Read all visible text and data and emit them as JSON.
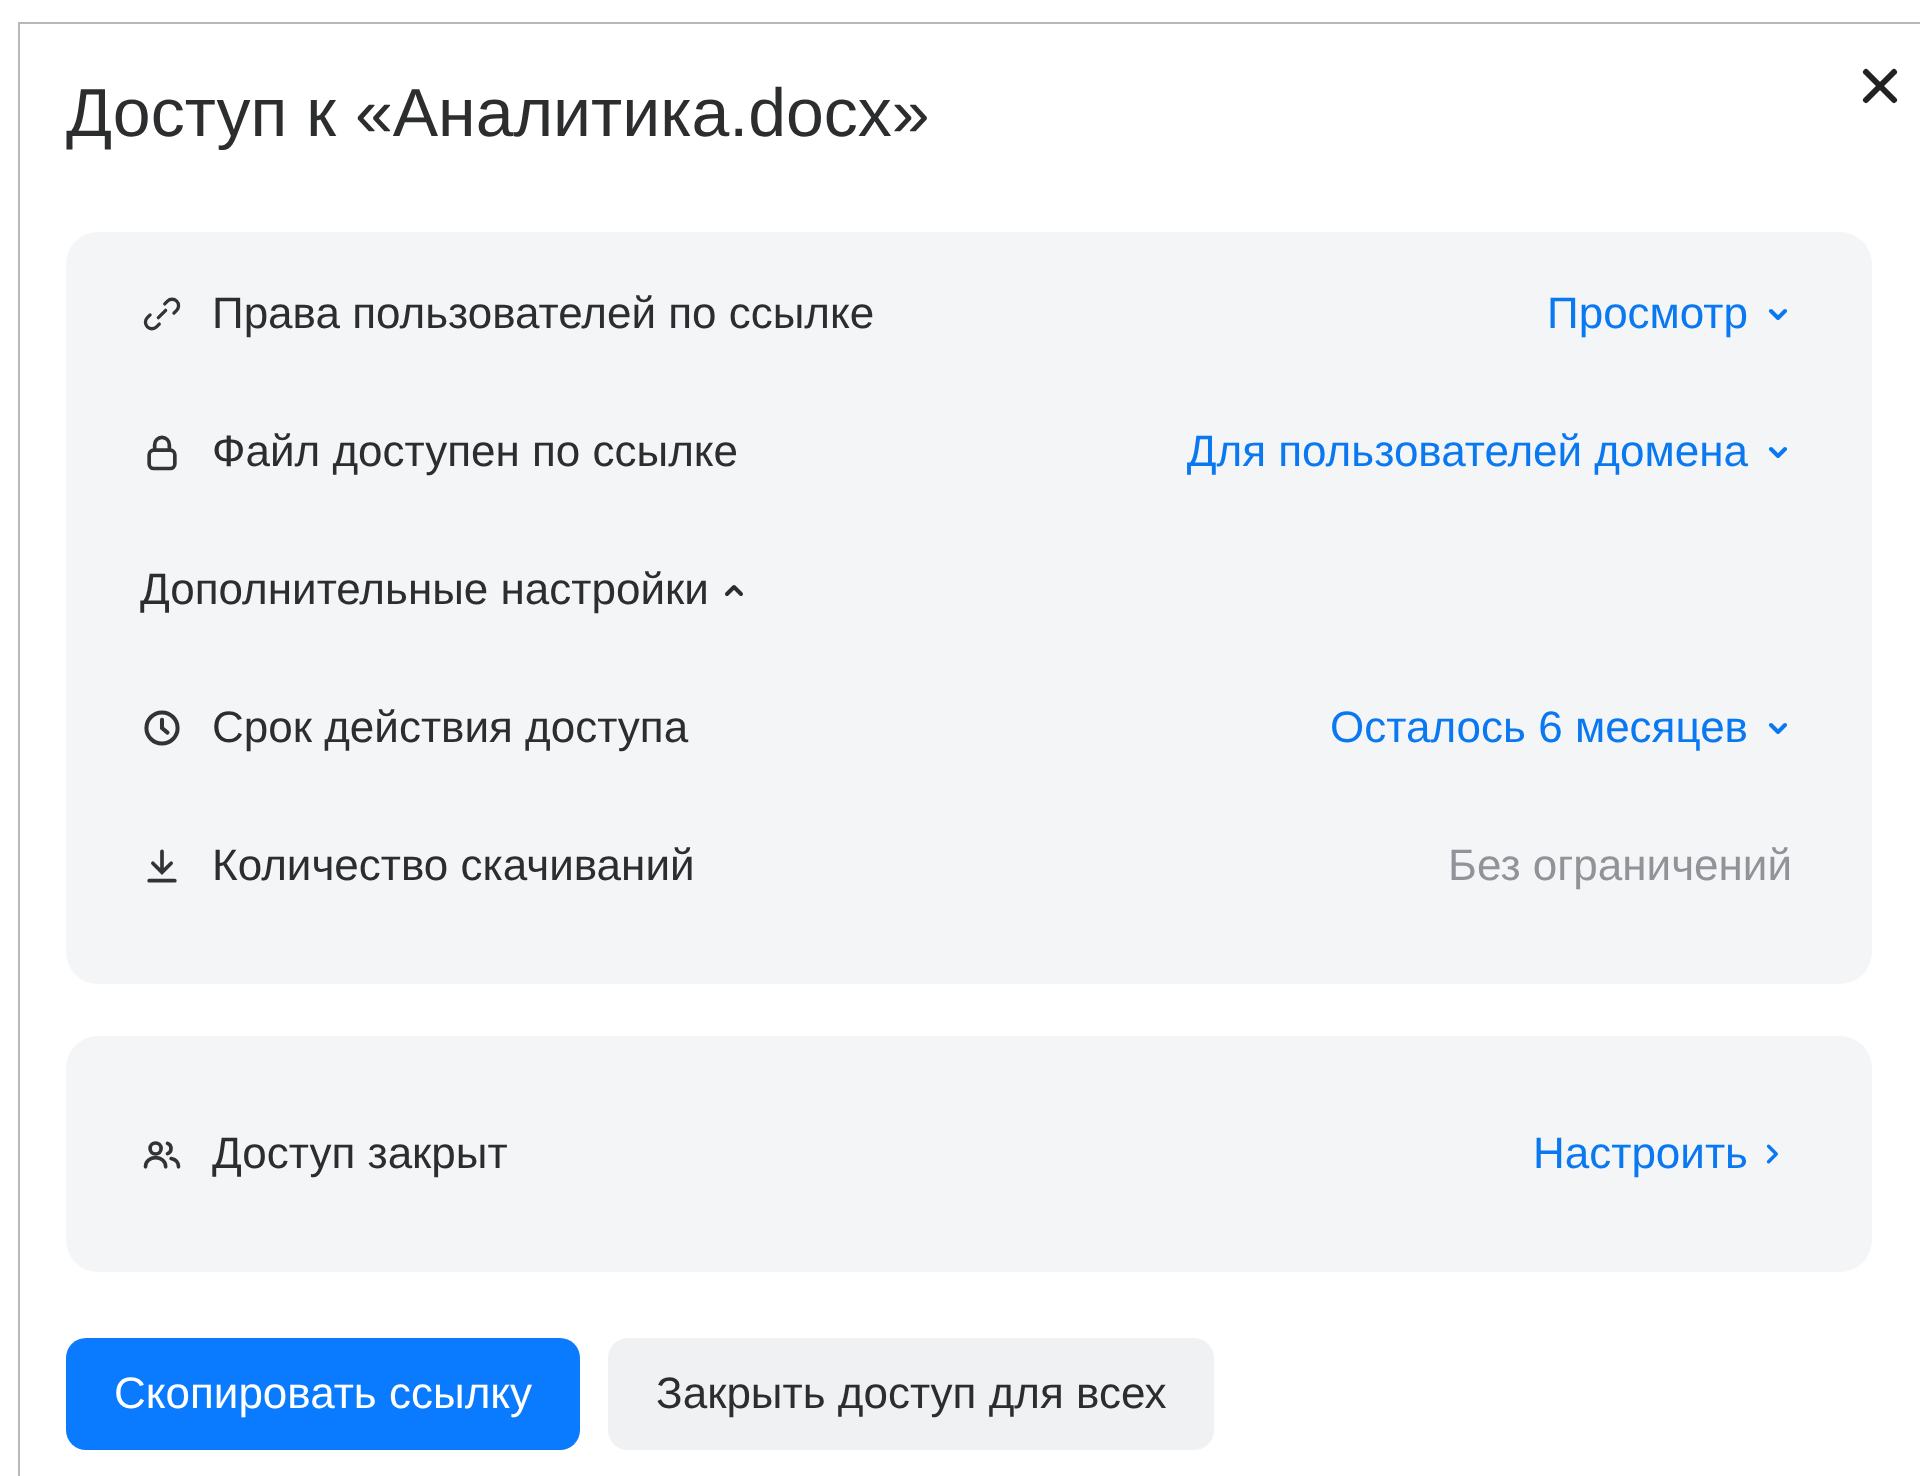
{
  "dialog": {
    "title": "Доступ к «Аналитика.docx»"
  },
  "link_settings": [
    {
      "kind": "dropdown",
      "label": "Права пользователей по ссылке",
      "value": "Просмотр"
    },
    {
      "kind": "dropdown",
      "label": "Файл доступен по ссылке",
      "value": "Для пользователей домена"
    },
    {
      "kind": "section",
      "label": "Дополнительные настройки",
      "expanded": true
    },
    {
      "kind": "dropdown",
      "label": "Срок действия доступа",
      "value": "Осталось 6 месяцев"
    },
    {
      "kind": "static",
      "label": "Количество скачиваний",
      "value": "Без ограничений"
    }
  ],
  "access": {
    "label": "Доступ закрыт",
    "action": "Настроить"
  },
  "buttons": [
    {
      "kind": "primary",
      "label": "Скопировать ссылку"
    },
    {
      "kind": "secondary",
      "label": "Закрыть доступ для всех"
    }
  ]
}
